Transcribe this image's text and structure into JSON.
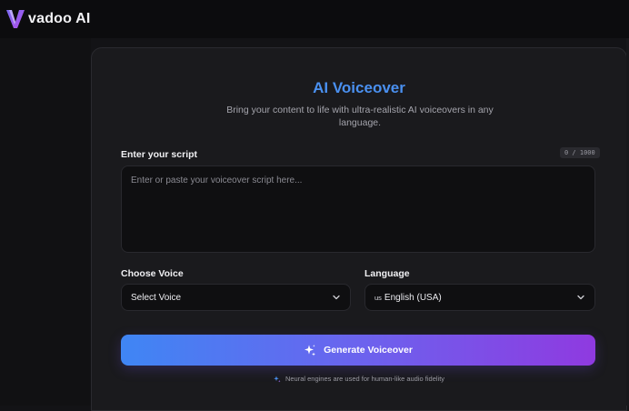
{
  "brand": {
    "name": "vadoo AI"
  },
  "page": {
    "title": "AI Voiceover",
    "subtitle": "Bring your content to life with ultra-realistic AI voiceovers in any language."
  },
  "script": {
    "label": "Enter your script",
    "counter": "0 / 1000",
    "value": "",
    "placeholder": "Enter or paste your voiceover script here..."
  },
  "voice": {
    "label": "Choose Voice",
    "selected": "Select Voice"
  },
  "language": {
    "label": "Language",
    "flag": "us",
    "selected": "English (USA)"
  },
  "generate": {
    "label": "Generate Voiceover",
    "icon": "sparkles-icon"
  },
  "footnote": "Neural engines are used for human-like audio fidelity",
  "colors": {
    "accent": "#4a90f0",
    "gradient_start": "#3f86f4",
    "gradient_end": "#8f3ae0",
    "background": "#131316",
    "card": "#1a1a1d"
  }
}
